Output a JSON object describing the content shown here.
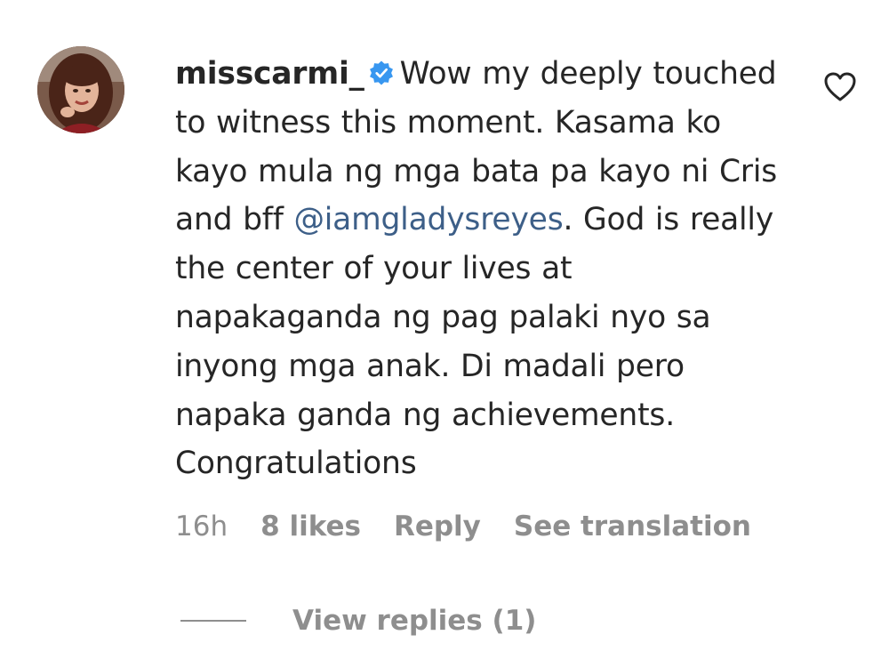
{
  "comment": {
    "username": "misscarmi_",
    "verified_icon": "verified-badge-icon",
    "text_part1": "Wow my deeply touched to witness this moment. Kasama ko kayo mula ng mga bata pa kayo ni Cris and bff",
    "mention": "@iamgladysreyes",
    "text_part2": ". God is really the center of your lives at napakaganda ng pag palaki nyo sa inyong mga anak. Di madali pero napaka ganda ng achievements. Congratulations",
    "age": "16h",
    "likes": "8 likes",
    "reply_label": "Reply",
    "translate_label": "See translation",
    "like_icon": "heart-outline-icon",
    "view_replies_label": "View replies (1)"
  },
  "colors": {
    "text": "#262626",
    "muted": "#8e8e8e",
    "mention": "#3d5f88",
    "verified": "#3897f0"
  }
}
